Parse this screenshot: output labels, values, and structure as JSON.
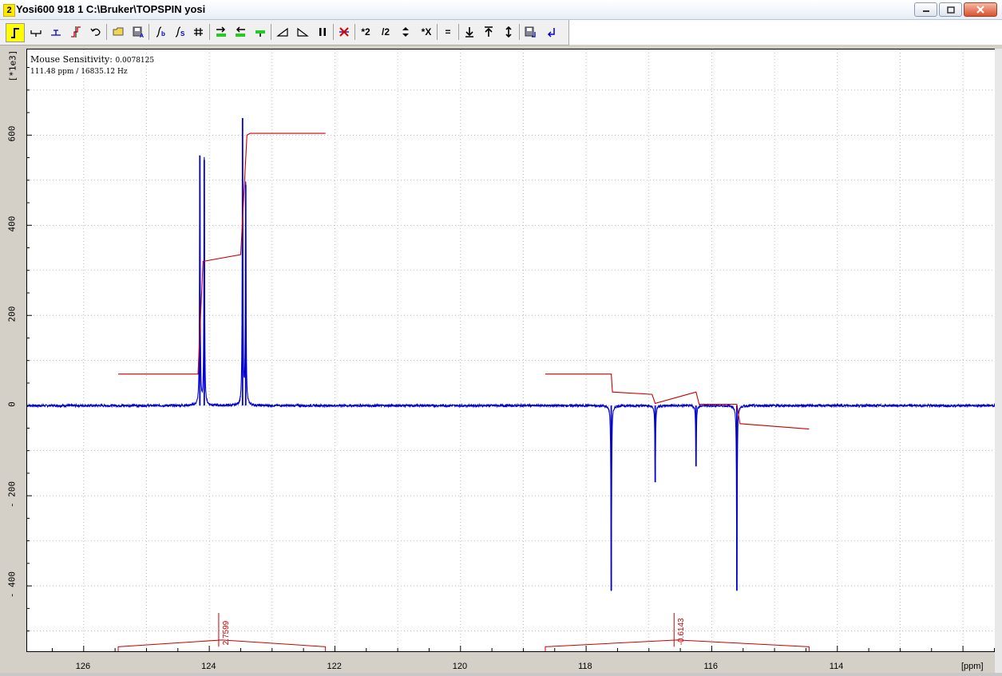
{
  "window": {
    "number": "2",
    "title": "Yosi600  918  1  C:\\Bruker\\TOPSPIN  yosi",
    "minimize_icon": "minimize-icon",
    "restore_icon": "restore-icon",
    "close_icon": "close-icon"
  },
  "toolbar": {
    "tools": [
      {
        "name": "integrate-mode-icon"
      },
      {
        "name": "define-region-icon"
      },
      {
        "name": "set-reference-icon"
      },
      {
        "name": "split-integral-icon"
      },
      {
        "name": "undo-icon"
      },
      {
        "name": "open-region-file-icon"
      },
      {
        "name": "save-region-icon"
      },
      {
        "name": "calibrate-integral-icon"
      },
      {
        "name": "scale-integral-icon"
      },
      {
        "name": "grid-icon"
      },
      {
        "name": "move-left-icon"
      },
      {
        "name": "move-right-icon"
      },
      {
        "name": "reset-icon"
      },
      {
        "name": "slope-bias-icon"
      },
      {
        "name": "slope-icon"
      },
      {
        "name": "pause-icon"
      },
      {
        "name": "delete-icon"
      },
      {
        "name": "multiply-2-icon",
        "label": "*2"
      },
      {
        "name": "divide-2-icon",
        "label": "/2"
      },
      {
        "name": "up-down-icon"
      },
      {
        "name": "multiply-x-icon",
        "label": "*X"
      },
      {
        "name": "equal-icon",
        "label": "="
      },
      {
        "name": "down-arrow-icon"
      },
      {
        "name": "up-arrow-icon"
      },
      {
        "name": "vertical-range-icon"
      },
      {
        "name": "save-return-icon"
      },
      {
        "name": "return-icon"
      }
    ]
  },
  "info": {
    "sensitivity_label": "Mouse Sensitivity:",
    "sensitivity_value": "0.0078125",
    "position_ppm": "111.48",
    "ppm_unit": "ppm /",
    "position_hz": "16835.12",
    "hz_unit": "Hz"
  },
  "y_axis_unit": "[*1e3]",
  "x_axis_unit": "[ppm]",
  "chart_data": {
    "type": "line",
    "xlabel": "[ppm]",
    "ylabel": "[*1e3]",
    "xlim": [
      126.9,
      111.48
    ],
    "ylim": [
      -545,
      790
    ],
    "x_ticks": [
      126,
      124,
      122,
      120,
      118,
      116,
      114
    ],
    "y_ticks": [
      600,
      400,
      200,
      0,
      -200,
      -400
    ],
    "y_tick_labels": [
      "600",
      "400",
      "200",
      "0",
      "- 200",
      "- 400"
    ],
    "grid": true,
    "series": [
      {
        "color": "#0000cc",
        "peaks": [
          {
            "x": 124.15,
            "y": 555
          },
          {
            "x": 124.08,
            "y": 545
          },
          {
            "x": 123.47,
            "y": 638
          },
          {
            "x": 123.42,
            "y": 490
          },
          {
            "x": 117.6,
            "y": -410
          },
          {
            "x": 116.9,
            "y": -170
          },
          {
            "x": 116.25,
            "y": -135
          },
          {
            "x": 115.6,
            "y": -410
          }
        ]
      },
      {
        "color": "#cc0000",
        "integral_regions": [
          {
            "x_start": 125.45,
            "x_end": 122.15,
            "points": [
              [
                125.45,
                70
              ],
              [
                124.18,
                70
              ],
              [
                124.1,
                320
              ],
              [
                123.5,
                335
              ],
              [
                123.4,
                600
              ],
              [
                123.35,
                604
              ],
              [
                122.15,
                604
              ]
            ]
          },
          {
            "x_start": 118.65,
            "x_end": 114.45,
            "points": [
              [
                118.65,
                70
              ],
              [
                117.6,
                70
              ],
              [
                117.58,
                30
              ],
              [
                116.95,
                25
              ],
              [
                116.9,
                5
              ],
              [
                116.25,
                30
              ],
              [
                116.2,
                3
              ],
              [
                115.6,
                3
              ],
              [
                115.55,
                -40
              ],
              [
                114.45,
                -52
              ]
            ]
          }
        ]
      }
    ],
    "integral_labels": [
      {
        "x": 123.85,
        "text": "2.7599"
      },
      {
        "x": 116.6,
        "text": "-0.6143"
      }
    ]
  },
  "colors": {
    "spectrum": "#0000cc",
    "integral": "#cc0000",
    "grid": "#9a9a9a",
    "active_tool": "#ffff00"
  }
}
